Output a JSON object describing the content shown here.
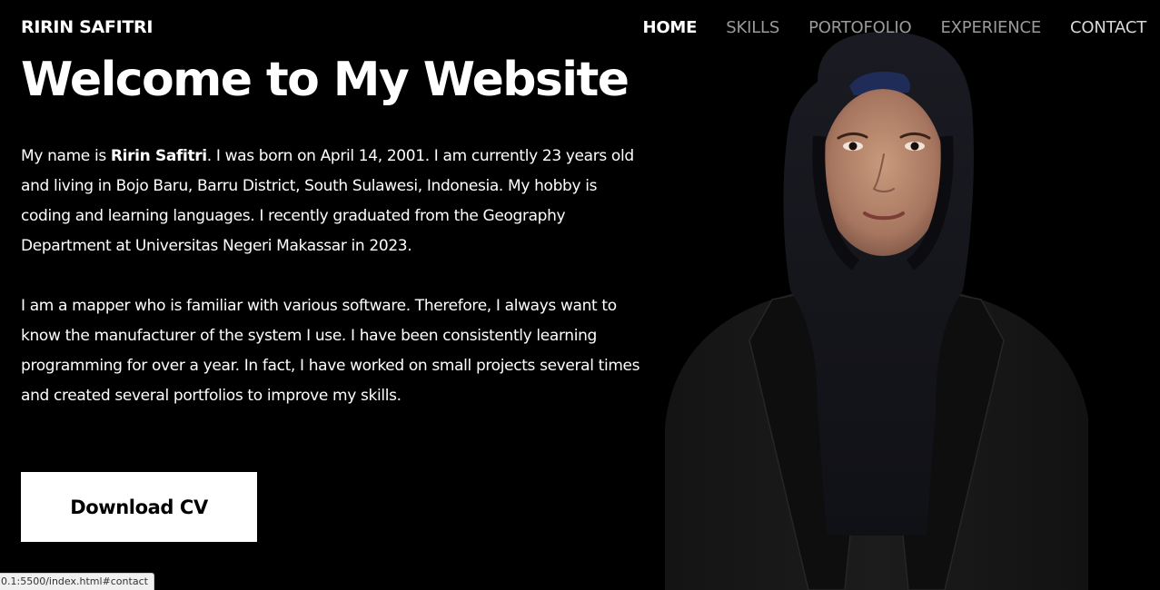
{
  "header": {
    "brand": "RIRIN SAFITRI",
    "nav": [
      {
        "label": "HOME",
        "active": true
      },
      {
        "label": "SKILLS",
        "active": false
      },
      {
        "label": "PORTOFOLIO",
        "active": false
      },
      {
        "label": "EXPERIENCE",
        "active": false
      },
      {
        "label": "CONTACT",
        "active": false
      }
    ]
  },
  "hero": {
    "title": "Welcome to My Website",
    "paragraph1": {
      "prefix": "My name is ",
      "name": "Ririn Safitri",
      "suffix": ". I was born on April 14, 2001. I am currently 23 years old and living in Bojo Baru, Barru District, South Sulawesi, Indonesia. My hobby is coding and learning languages. I recently graduated from the Geography Department at Universitas Negeri Makassar in 2023."
    },
    "paragraph2": "I am a mapper who is familiar with various software. Therefore, I always want to know the manufacturer of the system I use. I have been consistently learning programming for over a year. In fact, I have worked on small projects several times and created several portfolios to improve my skills.",
    "cta_label": "Download CV"
  },
  "status_bar": {
    "url": "0.1:5500/index.html#contact"
  },
  "colors": {
    "background": "#000000",
    "text": "#ffffff",
    "nav_inactive": "#9a9a9a",
    "button_bg": "#ffffff",
    "button_text": "#000000"
  }
}
